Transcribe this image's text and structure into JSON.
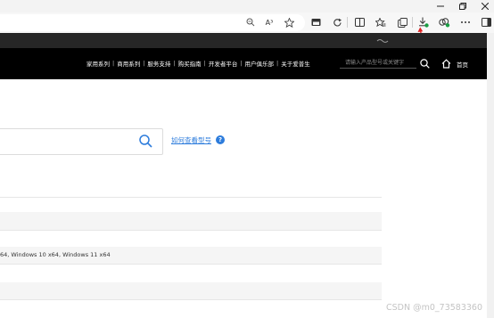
{
  "window": {
    "minimize_icon": "minimize-icon",
    "maximize_icon": "restore-icon",
    "close_icon": "close-icon"
  },
  "browser_toolbar": {
    "icons": [
      "zoom-icon",
      "read-aloud-icon",
      "favorite-star-icon",
      "app-available-icon",
      "refresh-icon",
      "split-screen-icon",
      "favorites-icon",
      "collections-icon",
      "downloads-icon",
      "extensions-icon",
      "settings-more-icon",
      "sidebar-icon"
    ],
    "read_aloud_label": "A³"
  },
  "site_header": {
    "nav": [
      "家用系列",
      "商用系列",
      "服务支持",
      "购买指南",
      "开发者平台",
      "用户俱乐部",
      "关于爱普生"
    ],
    "search_placeholder": "请输入产品型号或关键字",
    "home_label": "首页"
  },
  "main": {
    "help_link": "如何查看型号",
    "help_icon": "?",
    "os_text": "64, Windows 10 x64, Windows 11 x64"
  },
  "watermark": "CSDN @m0_73583360",
  "colors": {
    "accent": "#2d7cdc",
    "annotation_red": "#e02020"
  }
}
